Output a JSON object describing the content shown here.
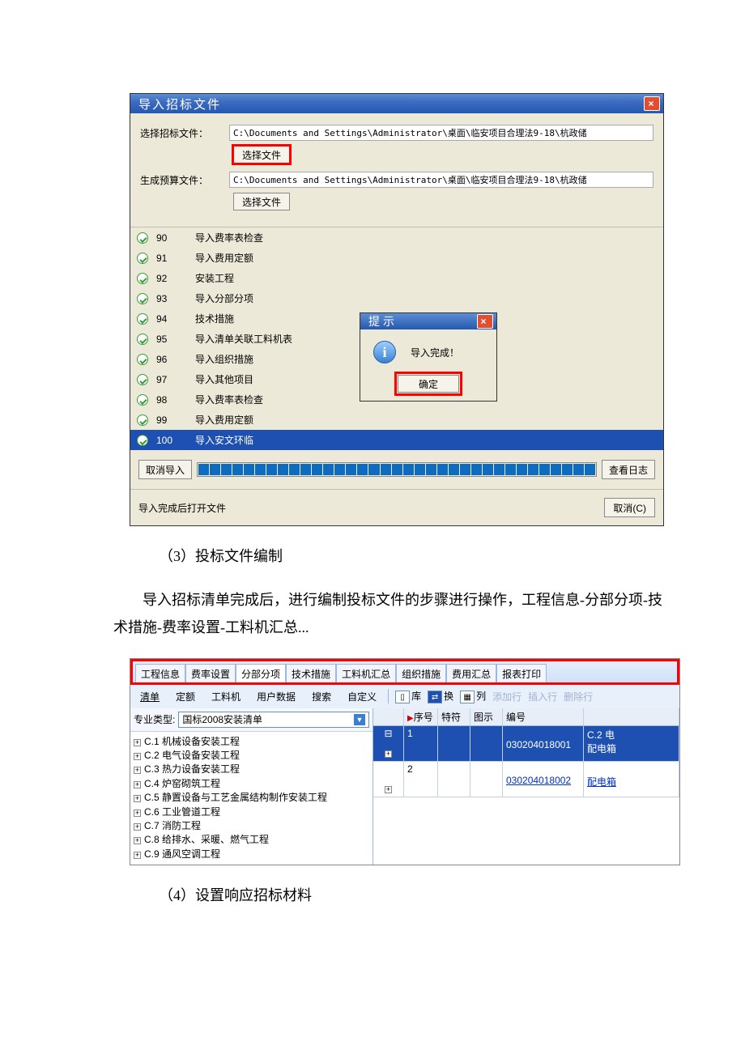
{
  "dialog1": {
    "title": "导入招标文件",
    "label_select": "选择招标文件：",
    "path1": "C:\\Documents and Settings\\Administrator\\桌面\\临安项目合理法9-18\\杭政储",
    "btn_choose": "选择文件",
    "label_gen": "生成预算文件：",
    "path2": "C:\\Documents and Settings\\Administrator\\桌面\\临安项目合理法9-18\\杭政储",
    "log": [
      {
        "n": "90",
        "t": "导入费率表检查"
      },
      {
        "n": "91",
        "t": "导入费用定额"
      },
      {
        "n": "92",
        "t": "安装工程"
      },
      {
        "n": "93",
        "t": "导入分部分项"
      },
      {
        "n": "94",
        "t": "技术措施"
      },
      {
        "n": "95",
        "t": "导入清单关联工料机表"
      },
      {
        "n": "96",
        "t": "导入组织措施"
      },
      {
        "n": "97",
        "t": "导入其他项目"
      },
      {
        "n": "98",
        "t": "导入费率表检查"
      },
      {
        "n": "99",
        "t": "导入费用定额"
      },
      {
        "n": "100",
        "t": "导入安文环临"
      }
    ],
    "tip_title": "提示",
    "tip_msg": "导入完成！",
    "tip_ok": "确定",
    "btn_cancel_import": "取消导入",
    "btn_viewlog": "查看日志",
    "after_open": "导入完成后打开文件",
    "btn_cancel": "取消(C)"
  },
  "para1": "（3）投标文件编制",
  "para2": "导入招标清单完成后，进行编制投标文件的步骤进行操作，工程信息-分部分项-技术措施-费率设置-工料机汇总...",
  "shot2": {
    "tabs": [
      "工程信息",
      "费率设置",
      "分部分项",
      "技术措施",
      "工料机汇总",
      "组织措施",
      "费用汇总",
      "报表打印"
    ],
    "subtabs": [
      "清单",
      "定额",
      "工料机",
      "用户数据",
      "搜索",
      "自定义"
    ],
    "ibtn_lib": "库",
    "ibtn_swap": "换",
    "ibtn_col": "列",
    "ghost1": "添加行",
    "ghost2": "插入行",
    "ghost3": "删除行",
    "type_label": "专业类型:",
    "type_value": "国标2008安装清单",
    "tree": [
      "C.1 机械设备安装工程",
      "C.2 电气设备安装工程",
      "C.3 热力设备安装工程",
      "C.4 炉窑砌筑工程",
      "C.5 静置设备与工艺金属结构制作安装工程",
      "C.6 工业管道工程",
      "C.7 消防工程",
      "C.8 给排水、采暖、燃气工程",
      "C.9 通风空调工程"
    ],
    "gridhead": {
      "seq": "序号",
      "spec": "特符",
      "ico": "图示",
      "num": "编号"
    },
    "row1": {
      "seq": "1",
      "num": "030204018001",
      "name": "配电箱",
      "head": "C.2 电"
    },
    "row2": {
      "seq": "2",
      "num": "030204018002",
      "name": "配电箱"
    }
  },
  "para3": "（4）设置响应招标材料"
}
